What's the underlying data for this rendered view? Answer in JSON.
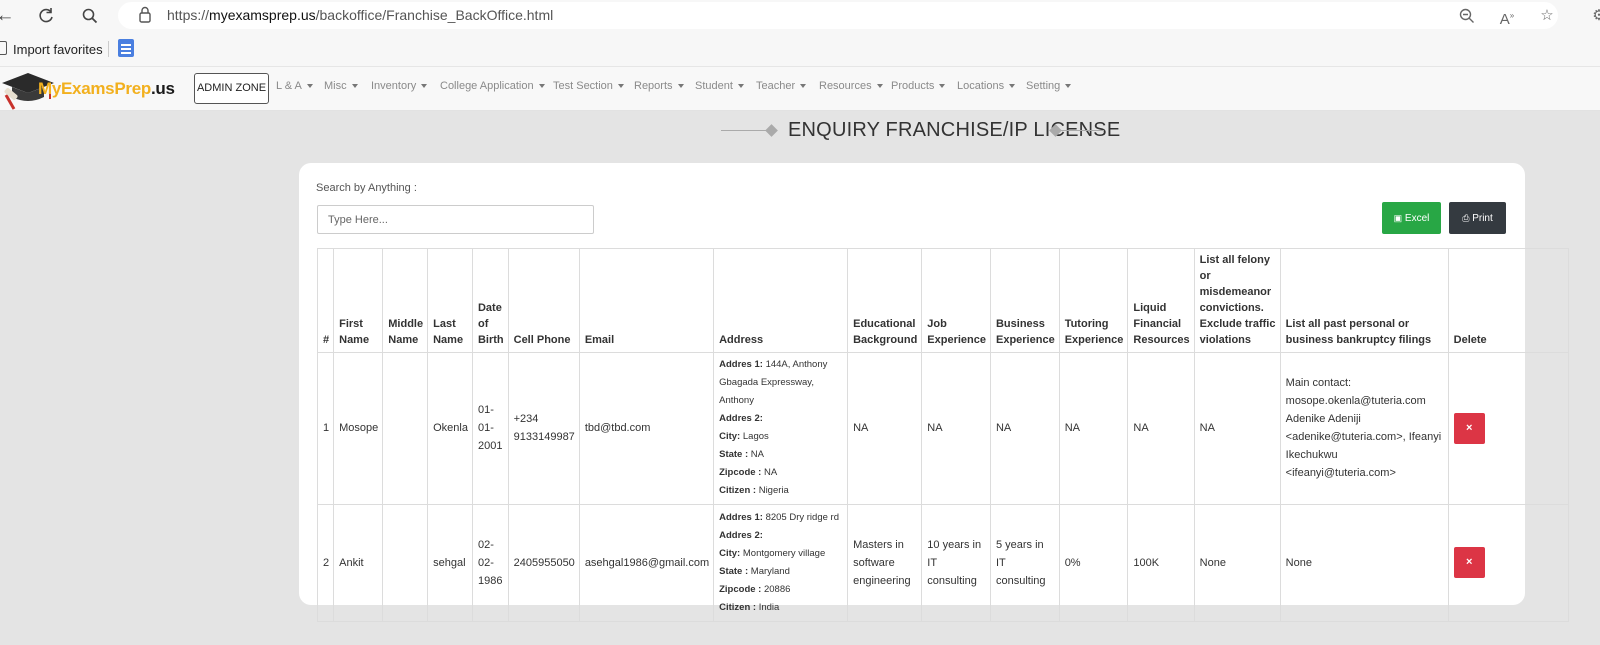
{
  "browser": {
    "url_prefix": "https://",
    "url_domain": "myexamsprep.us",
    "url_path": "/backoffice/Franchise_BackOffice.html",
    "favorites_label": "Import favorites"
  },
  "nav": {
    "logo_yellow": "MyExamsPrep",
    "logo_dark": ".us",
    "admin_zone": "ADMIN ZONE",
    "menu": [
      "L & A",
      "Misc",
      "Inventory",
      "College Application",
      "Test Section",
      "Reports",
      "Student",
      "Teacher",
      "Resources",
      "Products",
      "Locations",
      "Setting"
    ]
  },
  "page": {
    "title": "ENQUIRY FRANCHISE/IP LICENSE",
    "search_label": "Search by Anything :",
    "search_placeholder": "Type Here...",
    "excel_label": "Excel",
    "print_label": "Print"
  },
  "table": {
    "headers": [
      "#",
      "First Name",
      "Middle Name",
      "Last Name",
      "Date of Birth",
      "Cell Phone",
      "Email",
      "Address",
      "Educational Background",
      "Job Experience",
      "Business Experience",
      "Tutoring Experience",
      "Liquid Financial Resources",
      "List all felony or misdemeanor convictions. Exclude traffic violations",
      "List all past personal or business bankruptcy filings",
      "Delete"
    ],
    "address_labels": {
      "addr1": "Addres 1:",
      "addr2": "Addres 2:",
      "city": "City:",
      "state": "State :",
      "zip": "Zipcode :",
      "citizen": "Citizen :"
    },
    "rows": [
      {
        "num": "1",
        "first": "Mosope",
        "middle": "",
        "last": "Okenla",
        "dob": "01-01-2001",
        "phone": "+234 9133149987",
        "email": "tbd@tbd.com",
        "addr1": "144A, Anthony Gbagada Expressway, Anthony",
        "addr2": "",
        "city": "Lagos",
        "state": "NA",
        "zip": "NA",
        "citizen": "Nigeria",
        "education": "NA",
        "job": "NA",
        "business": "NA",
        "tutoring": "NA",
        "liquid": "NA",
        "felony": "NA",
        "bankruptcy": "Main contact: mosope.okenla@tuteria.com Adenike Adeniji <adenike@tuteria.com>, Ifeanyi Ikechukwu <ifeanyi@tuteria.com>",
        "delete": "×"
      },
      {
        "num": "2",
        "first": "Ankit",
        "middle": "",
        "last": "sehgal",
        "dob": "02-02-1986",
        "phone": "2405955050",
        "email": "asehgal1986@gmail.com",
        "addr1": "8205 Dry ridge rd",
        "addr2": "",
        "city": "Montgomery village",
        "state": "Maryland",
        "zip": "20886",
        "citizen": "India",
        "education": "Masters in software engineering",
        "job": "10 years in IT consulting",
        "business": "5 years in IT consulting",
        "tutoring": "0%",
        "liquid": "100K",
        "felony": "None",
        "bankruptcy": "None",
        "delete": "×"
      }
    ]
  }
}
